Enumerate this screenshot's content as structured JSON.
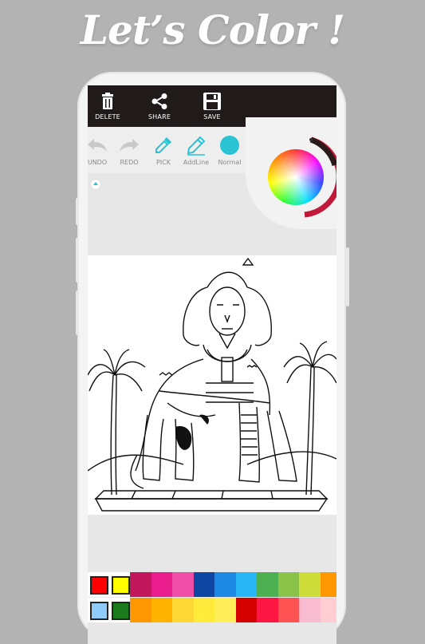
{
  "headline": "Let’s Color !",
  "toolbar": {
    "delete": "DELETE",
    "share": "SHARE",
    "save": "SAVE"
  },
  "tools": {
    "undo": "UNDO",
    "redo": "REDO",
    "pick": "PICK",
    "addline": "AddLine",
    "normal": "Normal"
  },
  "colors": {
    "accent": "#29c3d3",
    "toolbar_bg": "#201a1a"
  },
  "palette": {
    "row1": [
      "#ff0000",
      "#ffff00",
      "#c2185b",
      "#e91e8c",
      "#ef4fa6",
      "#0d47a1",
      "#1e88e5",
      "#29b6f6",
      "#4caf50",
      "#8bc34a",
      "#cddc39",
      "#ff9800"
    ],
    "row2": [
      "#90caf9",
      "#1b7a1b",
      "#ff9800",
      "#ffb300",
      "#fdd835",
      "#ffeb3b",
      "#ffee58",
      "#d50000",
      "#ff1744",
      "#ff5252",
      "#f8bbd0",
      "#ffcdd2"
    ]
  }
}
